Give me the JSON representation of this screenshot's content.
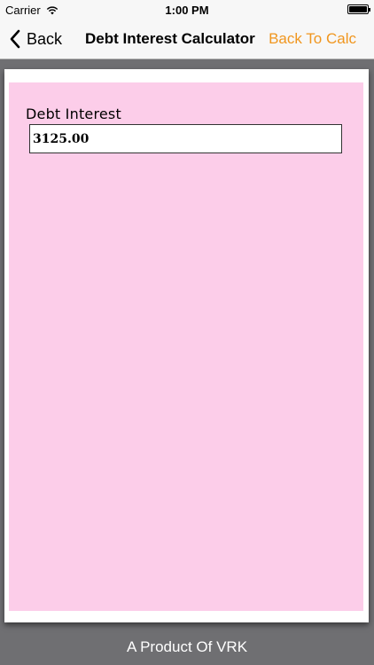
{
  "statusbar": {
    "carrier": "Carrier",
    "time": "1:00 PM"
  },
  "nav": {
    "back_label": "Back",
    "title": "Debt Interest Calculator",
    "right_label": "Back To Calc"
  },
  "form": {
    "debt_interest_label": "Debt Interest",
    "debt_interest_value": "3125.00"
  },
  "footer": {
    "text": "A Product Of VRK"
  },
  "colors": {
    "accent": "#f0961e",
    "panel": "#fccde9",
    "background": "#6f6f72"
  }
}
